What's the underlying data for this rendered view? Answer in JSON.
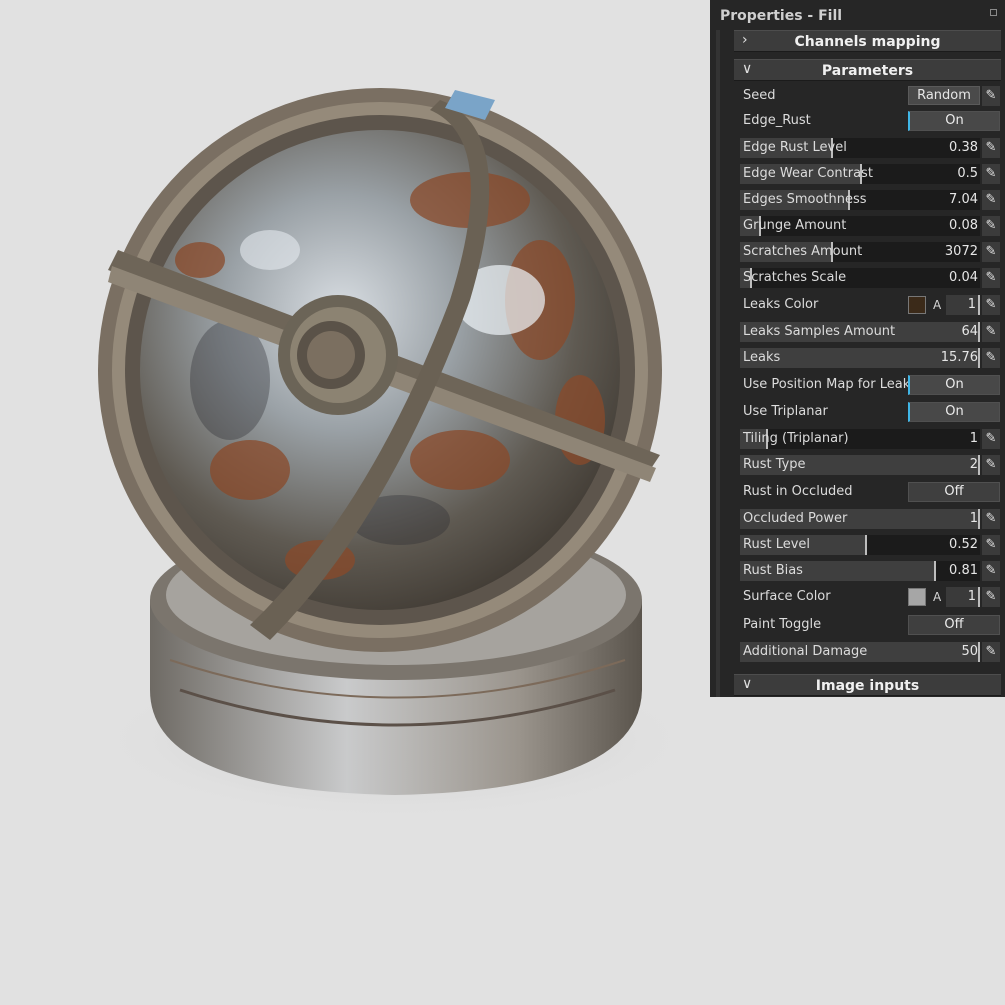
{
  "panel": {
    "title": "Properties - Fill",
    "sections": {
      "channels": "Channels mapping",
      "parameters": "Parameters",
      "image_inputs": "Image inputs"
    },
    "chevron_right": "›",
    "chevron_down": "∨",
    "pencil": "✎",
    "seed": {
      "label": "Seed",
      "button": "Random"
    },
    "edge_rust": {
      "label": "Edge_Rust",
      "value": "On"
    },
    "sliders": [
      {
        "label": "Edge Rust Level",
        "value": "0.38",
        "fraction": 0.38
      },
      {
        "label": "Edge Wear Contrast",
        "value": "0.5",
        "fraction": 0.5
      },
      {
        "label": "Edges Smoothness",
        "value": "7.04",
        "fraction": 0.45
      },
      {
        "label": "Grunge Amount",
        "value": "0.08",
        "fraction": 0.08
      },
      {
        "label": "Scratches Amount",
        "value": "3072",
        "fraction": 0.38
      },
      {
        "label": "Scratches Scale",
        "value": "0.04",
        "fraction": 0.04
      }
    ],
    "leaks_color": {
      "label": "Leaks Color",
      "swatch": "#3b2a19",
      "alpha_label": "A",
      "alpha": "1"
    },
    "sliders2": [
      {
        "label": "Leaks Samples Amount",
        "value": "64",
        "fraction": 1.0
      },
      {
        "label": "Leaks",
        "value": "15.76",
        "fraction": 1.0
      }
    ],
    "toggles": [
      {
        "label": "Use Position Map for Leaks",
        "value": "On"
      },
      {
        "label": "Use Triplanar",
        "value": "On"
      }
    ],
    "sliders3": [
      {
        "label": "Tiling (Triplanar)",
        "value": "1",
        "fraction": 0.11
      },
      {
        "label": "Rust Type",
        "value": "2",
        "fraction": 1.0
      }
    ],
    "rust_occluded": {
      "label": "Rust in Occluded",
      "value": "Off"
    },
    "sliders4": [
      {
        "label": "Occluded Power",
        "value": "1",
        "fraction": 1.0
      },
      {
        "label": "Rust Level",
        "value": "0.52",
        "fraction": 0.52
      },
      {
        "label": "Rust Bias",
        "value": "0.81",
        "fraction": 0.81
      }
    ],
    "surface_color": {
      "label": "Surface Color",
      "swatch": "#a6a6a6",
      "alpha_label": "A",
      "alpha": "1"
    },
    "paint_toggle": {
      "label": "Paint Toggle",
      "value": "Off"
    },
    "additional_damage": {
      "label": "Additional Damage",
      "value": "50",
      "fraction": 1.0
    }
  },
  "colors": {
    "background": "#e1e1e1",
    "panel": "#262626",
    "accent": "#3fb6e6"
  }
}
